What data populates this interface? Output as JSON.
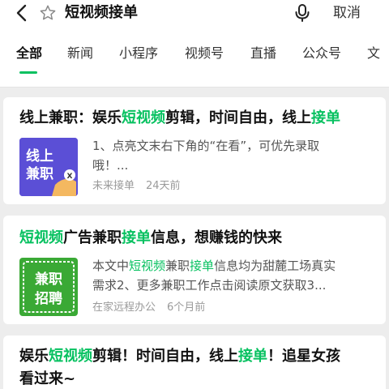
{
  "search": {
    "query": "短视频接单",
    "cancel_label": "取消"
  },
  "tabs": [
    {
      "label": "全部",
      "active": true
    },
    {
      "label": "新闻",
      "active": false
    },
    {
      "label": "小程序",
      "active": false
    },
    {
      "label": "视频号",
      "active": false
    },
    {
      "label": "直播",
      "active": false
    },
    {
      "label": "公众号",
      "active": false
    },
    {
      "label": "文",
      "active": false
    }
  ],
  "results": [
    {
      "title_parts": [
        {
          "text": "线上兼职：娱乐",
          "highlight": false
        },
        {
          "text": "短视频",
          "highlight": true
        },
        {
          "text": "剪辑，时间自由，线上",
          "highlight": false
        },
        {
          "text": "接单",
          "highlight": true
        }
      ],
      "thumb_text": [
        "线上",
        "兼职"
      ],
      "desc_line1": "1、点亮文末右下角的“在看”，可优先录取",
      "desc_line2": "哦！...",
      "source": "未来接单",
      "time": "24天前"
    },
    {
      "title_parts": [
        {
          "text": "短视频",
          "highlight": true
        },
        {
          "text": "广告兼职",
          "highlight": false
        },
        {
          "text": "接单",
          "highlight": true
        },
        {
          "text": "信息，想赚钱的快来",
          "highlight": false
        }
      ],
      "thumb_text": [
        "兼职",
        "招聘"
      ],
      "desc_parts_line1": [
        {
          "text": "本文中",
          "highlight": false
        },
        {
          "text": "短视频",
          "highlight": true
        },
        {
          "text": "兼职",
          "highlight": false
        },
        {
          "text": "接单",
          "highlight": true
        },
        {
          "text": "信息均为甜麓工场真实",
          "highlight": false
        }
      ],
      "desc_line2": "需求2、更多兼职工作点击阅读原文获取3...",
      "source": "在家远程办公",
      "time": "6个月前"
    },
    {
      "title_line1_parts": [
        {
          "text": "娱乐",
          "highlight": false
        },
        {
          "text": "短视频",
          "highlight": true
        },
        {
          "text": "剪辑！时间自由，线上",
          "highlight": false
        },
        {
          "text": "接单",
          "highlight": true
        },
        {
          "text": "！追星女孩",
          "highlight": false
        }
      ],
      "title_line2": "看过来~"
    }
  ],
  "colors": {
    "accent": "#07c160",
    "thumb1_bg": "#5b4fd6",
    "thumb2_bg": "#3aa935"
  }
}
